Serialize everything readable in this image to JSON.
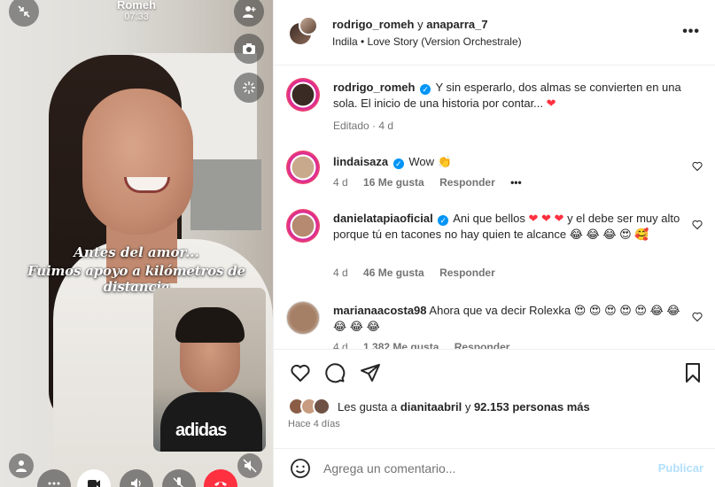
{
  "call": {
    "caller_name": "Romeh",
    "timer": "07:33",
    "caption_line1": "Antes del amor...",
    "caption_line2": "Fuimos apoyo a kilómetros de distancia",
    "pip_logo_text": "adidas",
    "top_left_icon": "minimize-arrows-icon",
    "top_right_icons": [
      "add-person-icon",
      "camera-icon",
      "effects-sparkle-icon"
    ],
    "bottom_icons": [
      "person-icon",
      "mute-speaker-icon"
    ],
    "controls": [
      "more-icon",
      "video-icon",
      "speaker-icon",
      "microphone-off-icon",
      "end-call-icon"
    ],
    "end_call_color": "#ff3040"
  },
  "post": {
    "author1": "rodrigo_romeh",
    "connector": "y",
    "author2": "anaparra_7",
    "track": "Indila • Love Story (Version Orchestrale)",
    "more_label": "•••"
  },
  "caption": {
    "user": "rodrigo_romeh",
    "text": "Y sin esperarlo, dos almas se convierten en una sola. El inicio de una historia por contar...",
    "edited": "Editado · 4 d"
  },
  "comments": [
    {
      "user": "lindaisaza",
      "verified": true,
      "text": "Wow",
      "emojis": [
        "clap"
      ],
      "time": "4 d",
      "likes": "16 Me gusta",
      "reply": "Responder",
      "options": "•••"
    },
    {
      "user": "danielatapiaoficial",
      "verified": true,
      "text_a": "Ani que bellos",
      "text_b": "y el debe ser muy alto porque tú en tacones no hay quien te alcance",
      "time": "4 d",
      "likes": "46 Me gusta",
      "reply": "Responder"
    },
    {
      "user": "marianaacosta98",
      "verified": false,
      "text": "Ahora que va decir Rolexka",
      "time": "4 d",
      "likes": "1.382 Me gusta",
      "reply": "Responder"
    }
  ],
  "likes": {
    "prefix": "Les gusta a",
    "user": "dianitaabril",
    "connector": "y",
    "count": "92.153 personas más"
  },
  "date": "Hace 4 días",
  "composer": {
    "placeholder": "Agrega un comentario...",
    "publish": "Publicar"
  },
  "colors": {
    "verified": "#0095f6",
    "heart": "#ff3040",
    "muted_text": "#737373",
    "publish_disabled": "#b2dffc"
  }
}
